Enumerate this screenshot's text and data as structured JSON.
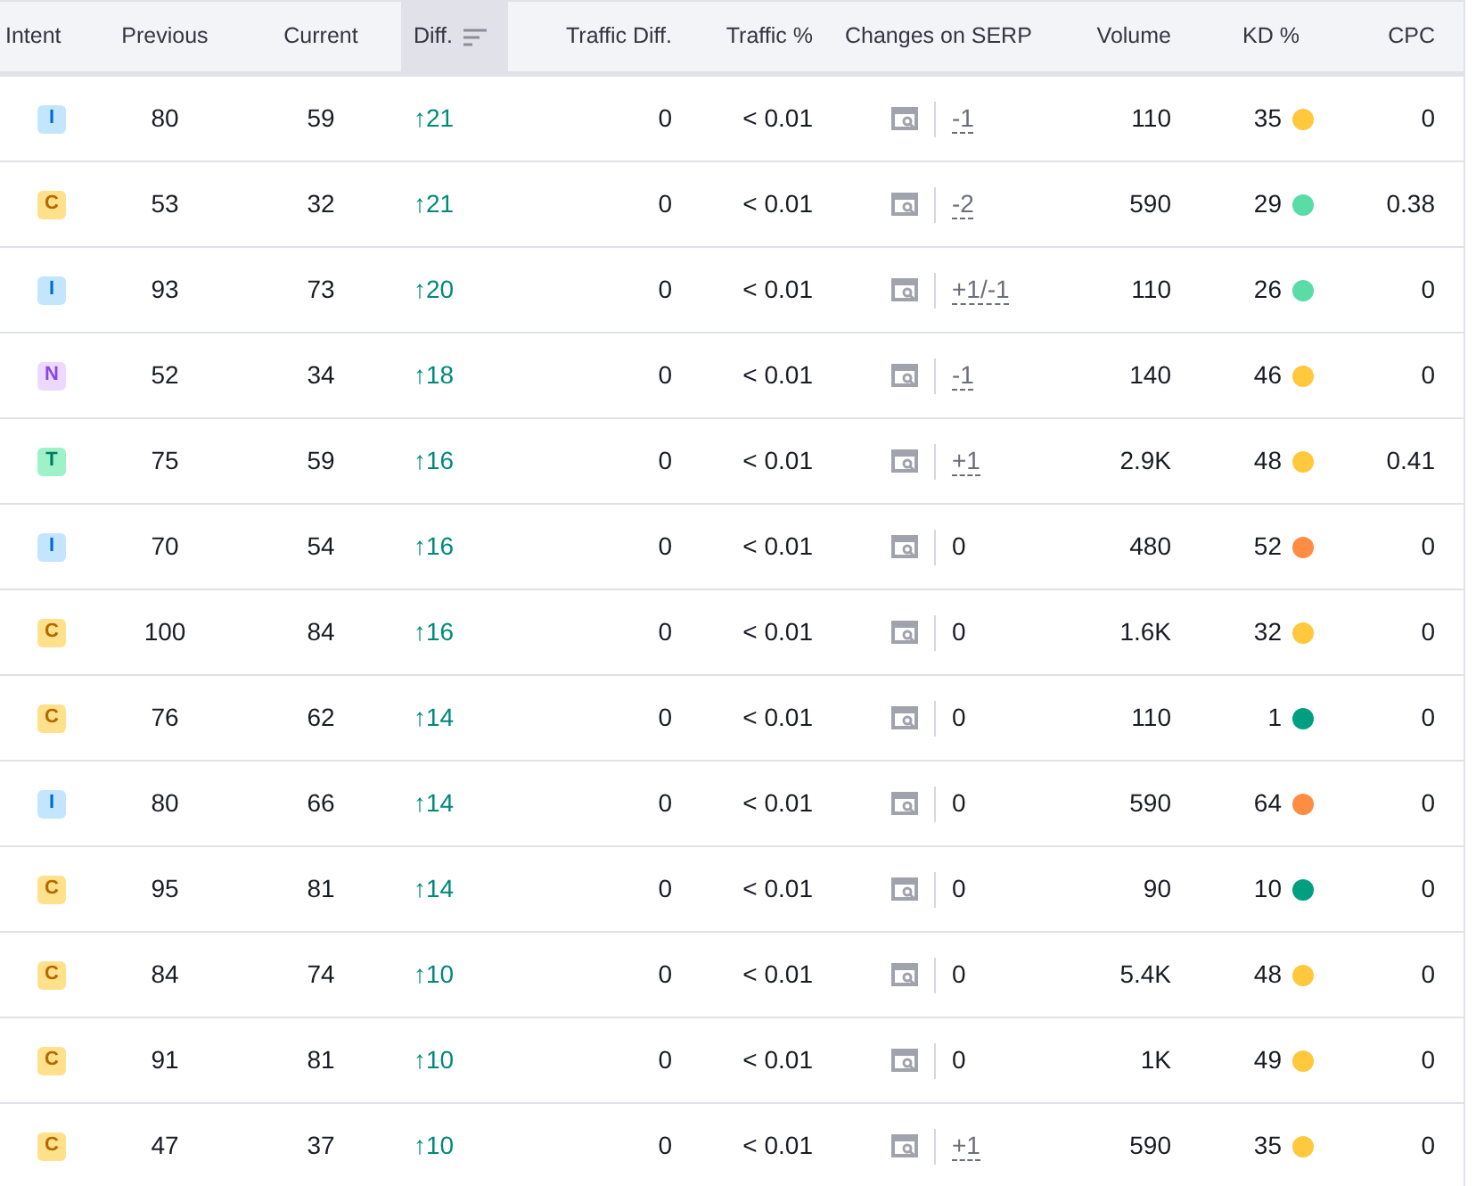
{
  "columns": [
    {
      "label": "Intent",
      "sorted": false
    },
    {
      "label": "Previous",
      "sorted": false
    },
    {
      "label": "Current",
      "sorted": false
    },
    {
      "label": "Diff.",
      "sorted": true
    },
    {
      "label": "Traffic Diff.",
      "sorted": false
    },
    {
      "label": "Traffic %",
      "sorted": false
    },
    {
      "label": "Changes on SERP",
      "sorted": false
    },
    {
      "label": "Volume",
      "sorted": false
    },
    {
      "label": "KD %",
      "sorted": false
    },
    {
      "label": "CPC",
      "sorted": false
    }
  ],
  "rows": [
    {
      "intent": {
        "label": "I",
        "color": "#c4e5fe"
      },
      "previous": "80",
      "current": "59",
      "diff": "↑21",
      "traffic_diff": "0",
      "traffic_pct": "< 0.01",
      "serp_change": {
        "text": "-1",
        "kind": "change"
      },
      "volume": "110",
      "kd": {
        "text": "35",
        "color": "#ffc83d"
      },
      "cpc": "0"
    },
    {
      "intent": {
        "label": "C",
        "color": "#ffe08b"
      },
      "previous": "53",
      "current": "32",
      "diff": "↑21",
      "traffic_diff": "0",
      "traffic_pct": "< 0.01",
      "serp_change": {
        "text": "-2",
        "kind": "change"
      },
      "volume": "590",
      "kd": {
        "text": "29",
        "color": "#5adca6"
      },
      "cpc": "0.38"
    },
    {
      "intent": {
        "label": "I",
        "color": "#c4e5fe"
      },
      "previous": "93",
      "current": "73",
      "diff": "↑20",
      "traffic_diff": "0",
      "traffic_pct": "< 0.01",
      "serp_change": {
        "text": "+1/-1",
        "kind": "change"
      },
      "volume": "110",
      "kd": {
        "text": "26",
        "color": "#5adca6"
      },
      "cpc": "0"
    },
    {
      "intent": {
        "label": "N",
        "color": "#edd9ff"
      },
      "previous": "52",
      "current": "34",
      "diff": "↑18",
      "traffic_diff": "0",
      "traffic_pct": "< 0.01",
      "serp_change": {
        "text": "-1",
        "kind": "change"
      },
      "volume": "140",
      "kd": {
        "text": "46",
        "color": "#ffc83d"
      },
      "cpc": "0"
    },
    {
      "intent": {
        "label": "T",
        "color": "#9ef2c9"
      },
      "previous": "75",
      "current": "59",
      "diff": "↑16",
      "traffic_diff": "0",
      "traffic_pct": "< 0.01",
      "serp_change": {
        "text": "+1",
        "kind": "change"
      },
      "volume": "2.9K",
      "kd": {
        "text": "48",
        "color": "#ffc83d"
      },
      "cpc": "0.41"
    },
    {
      "intent": {
        "label": "I",
        "color": "#c4e5fe"
      },
      "previous": "70",
      "current": "54",
      "diff": "↑16",
      "traffic_diff": "0",
      "traffic_pct": "< 0.01",
      "serp_change": {
        "text": "0",
        "kind": "none"
      },
      "volume": "480",
      "kd": {
        "text": "52",
        "color": "#ff8c43"
      },
      "cpc": "0"
    },
    {
      "intent": {
        "label": "C",
        "color": "#ffe08b"
      },
      "previous": "100",
      "current": "84",
      "diff": "↑16",
      "traffic_diff": "0",
      "traffic_pct": "< 0.01",
      "serp_change": {
        "text": "0",
        "kind": "none"
      },
      "volume": "1.6K",
      "kd": {
        "text": "32",
        "color": "#ffc83d"
      },
      "cpc": "0"
    },
    {
      "intent": {
        "label": "C",
        "color": "#ffe08b"
      },
      "previous": "76",
      "current": "62",
      "diff": "↑14",
      "traffic_diff": "0",
      "traffic_pct": "< 0.01",
      "serp_change": {
        "text": "0",
        "kind": "none"
      },
      "volume": "110",
      "kd": {
        "text": "1",
        "color": "#009f81"
      },
      "cpc": "0"
    },
    {
      "intent": {
        "label": "I",
        "color": "#c4e5fe"
      },
      "previous": "80",
      "current": "66",
      "diff": "↑14",
      "traffic_diff": "0",
      "traffic_pct": "< 0.01",
      "serp_change": {
        "text": "0",
        "kind": "none"
      },
      "volume": "590",
      "kd": {
        "text": "64",
        "color": "#ff8c43"
      },
      "cpc": "0"
    },
    {
      "intent": {
        "label": "C",
        "color": "#ffe08b"
      },
      "previous": "95",
      "current": "81",
      "diff": "↑14",
      "traffic_diff": "0",
      "traffic_pct": "< 0.01",
      "serp_change": {
        "text": "0",
        "kind": "none"
      },
      "volume": "90",
      "kd": {
        "text": "10",
        "color": "#009f81"
      },
      "cpc": "0"
    },
    {
      "intent": {
        "label": "C",
        "color": "#ffe08b"
      },
      "previous": "84",
      "current": "74",
      "diff": "↑10",
      "traffic_diff": "0",
      "traffic_pct": "< 0.01",
      "serp_change": {
        "text": "0",
        "kind": "none"
      },
      "volume": "5.4K",
      "kd": {
        "text": "48",
        "color": "#ffc83d"
      },
      "cpc": "0"
    },
    {
      "intent": {
        "label": "C",
        "color": "#ffe08b"
      },
      "previous": "91",
      "current": "81",
      "diff": "↑10",
      "traffic_diff": "0",
      "traffic_pct": "< 0.01",
      "serp_change": {
        "text": "0",
        "kind": "none"
      },
      "volume": "1K",
      "kd": {
        "text": "49",
        "color": "#ffc83d"
      },
      "cpc": "0"
    },
    {
      "intent": {
        "label": "C",
        "color": "#ffe08b"
      },
      "previous": "47",
      "current": "37",
      "diff": "↑10",
      "traffic_diff": "0",
      "traffic_pct": "< 0.01",
      "serp_change": {
        "text": "+1",
        "kind": "change"
      },
      "volume": "590",
      "kd": {
        "text": "35",
        "color": "#ffc83d"
      },
      "cpc": "0"
    }
  ]
}
